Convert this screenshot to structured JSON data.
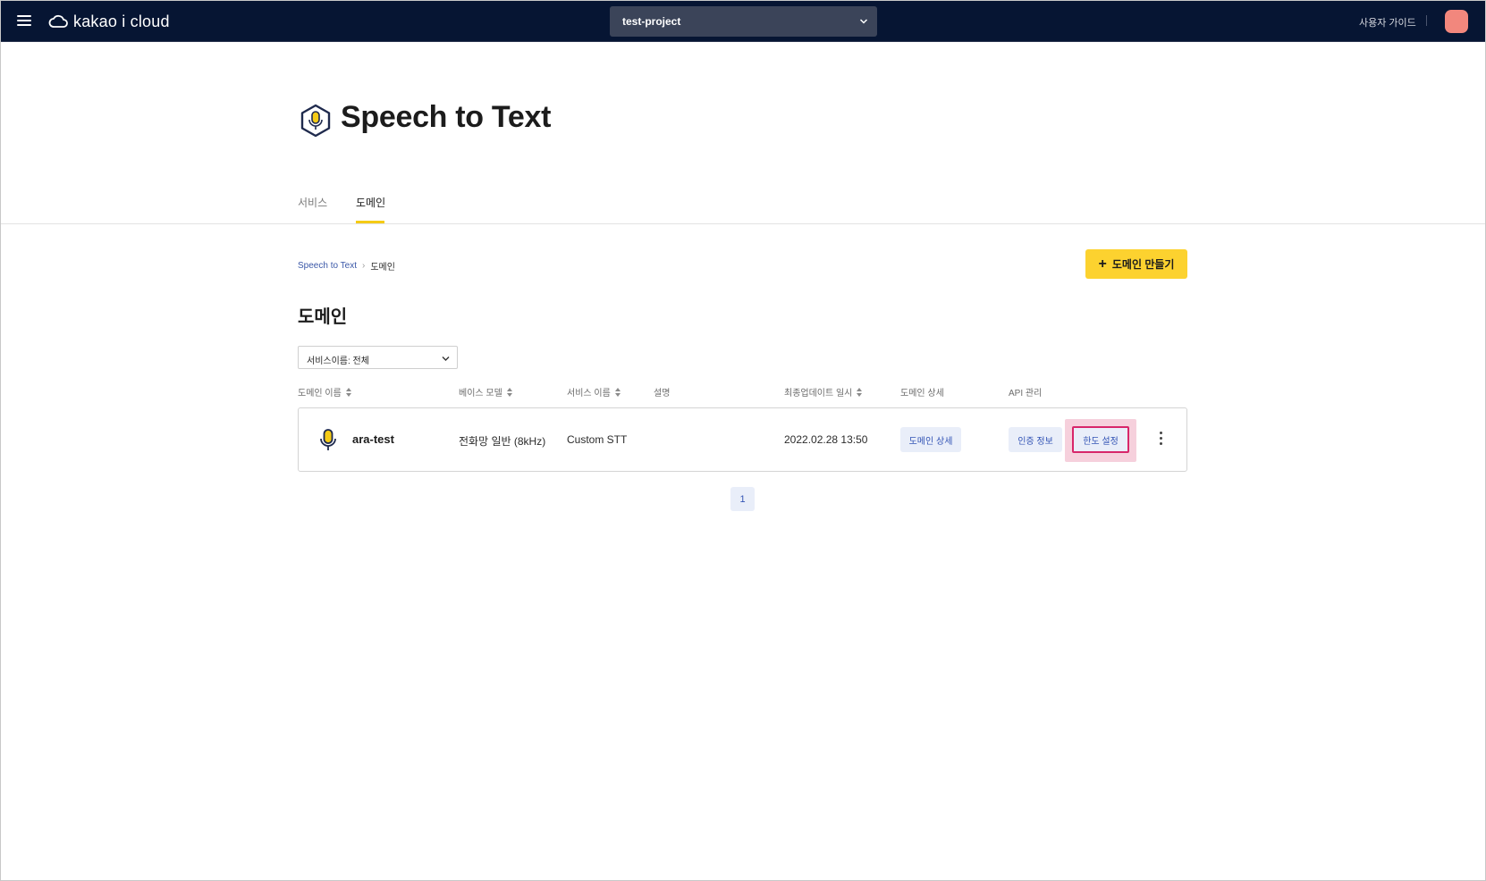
{
  "topbar": {
    "brand": "kakao i cloud",
    "project": "test-project",
    "user_guide": "사용자 가이드",
    "separator": "|"
  },
  "header": {
    "title": "Speech to Text"
  },
  "tabs": [
    {
      "label": "서비스",
      "active": false
    },
    {
      "label": "도메인",
      "active": true
    }
  ],
  "breadcrumb": {
    "root": "Speech to Text",
    "separator": "›",
    "current": "도메인"
  },
  "create_button": {
    "icon": "plus-icon",
    "label": "도메인 만들기"
  },
  "section_title": "도메인",
  "filter": {
    "value": "서비스이름: 전체"
  },
  "table": {
    "columns": [
      {
        "label": "도메인 이름",
        "sortable": true
      },
      {
        "label": "베이스 모델",
        "sortable": true
      },
      {
        "label": "서비스 이름",
        "sortable": true
      },
      {
        "label": "설명",
        "sortable": false
      },
      {
        "label": "최종업데이트 일시",
        "sortable": true
      },
      {
        "label": "도메인 상세",
        "sortable": false
      },
      {
        "label": "API 관리",
        "sortable": false
      }
    ],
    "rows": [
      {
        "icon": "microphone-icon",
        "name": "ara-test",
        "base_model": "전화망 일반 (8kHz)",
        "service": "Custom STT",
        "description": "",
        "updated": "2022.02.28 13:50",
        "detail_button": "도메인 상세",
        "auth_button": "인증 정보",
        "limit_button": "한도 설정"
      }
    ]
  },
  "pagination": {
    "current": "1"
  },
  "colors": {
    "topbar_bg": "#061533",
    "accent_yellow": "#fcd22f",
    "chip_bg": "#e9eef9",
    "chip_text": "#3354b5",
    "highlight_border": "#d8266a",
    "highlight_bg": "#f6d0dc",
    "avatar": "#f2877d"
  }
}
